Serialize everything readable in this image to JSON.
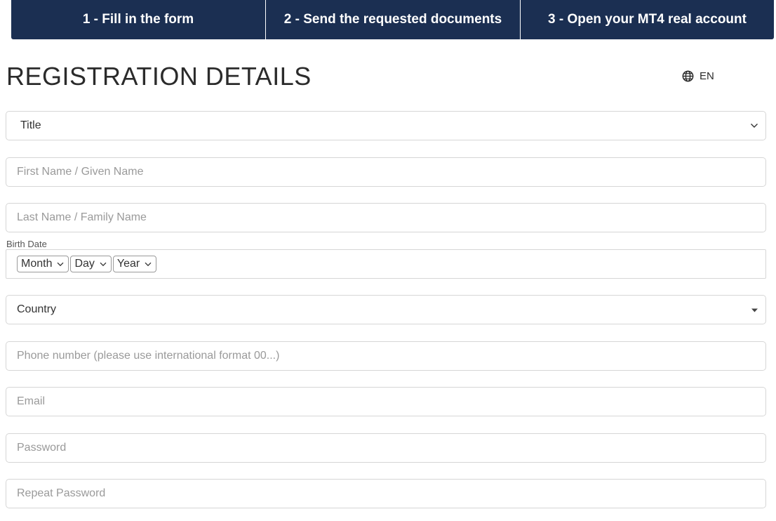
{
  "steps": [
    {
      "label": "1 - Fill in the form"
    },
    {
      "label": "2 - Send the requested documents"
    },
    {
      "label": "3 - Open your MT4 real account"
    }
  ],
  "page_title": "REGISTRATION DETAILS",
  "language": {
    "code": "EN",
    "icon": "globe-icon"
  },
  "form": {
    "title_select": {
      "value": "Title",
      "icon": "chevron-down-icon"
    },
    "first_name": {
      "placeholder": "First Name / Given Name"
    },
    "last_name": {
      "placeholder": "Last Name / Family Name"
    },
    "birth_date": {
      "label": "Birth Date",
      "month": "Month",
      "day": "Day",
      "year": "Year"
    },
    "country": {
      "value": "Country",
      "icon": "caret-down-icon"
    },
    "phone": {
      "placeholder": "Phone number (please use international format 00...)"
    },
    "email": {
      "placeholder": "Email"
    },
    "password": {
      "placeholder": "Password"
    },
    "repeat_password": {
      "placeholder": "Repeat Password"
    }
  },
  "colors": {
    "header_bg": "#1b2f52",
    "header_text": "#ffffff",
    "border": "#d6d6d6",
    "placeholder": "#9a9a9a"
  }
}
